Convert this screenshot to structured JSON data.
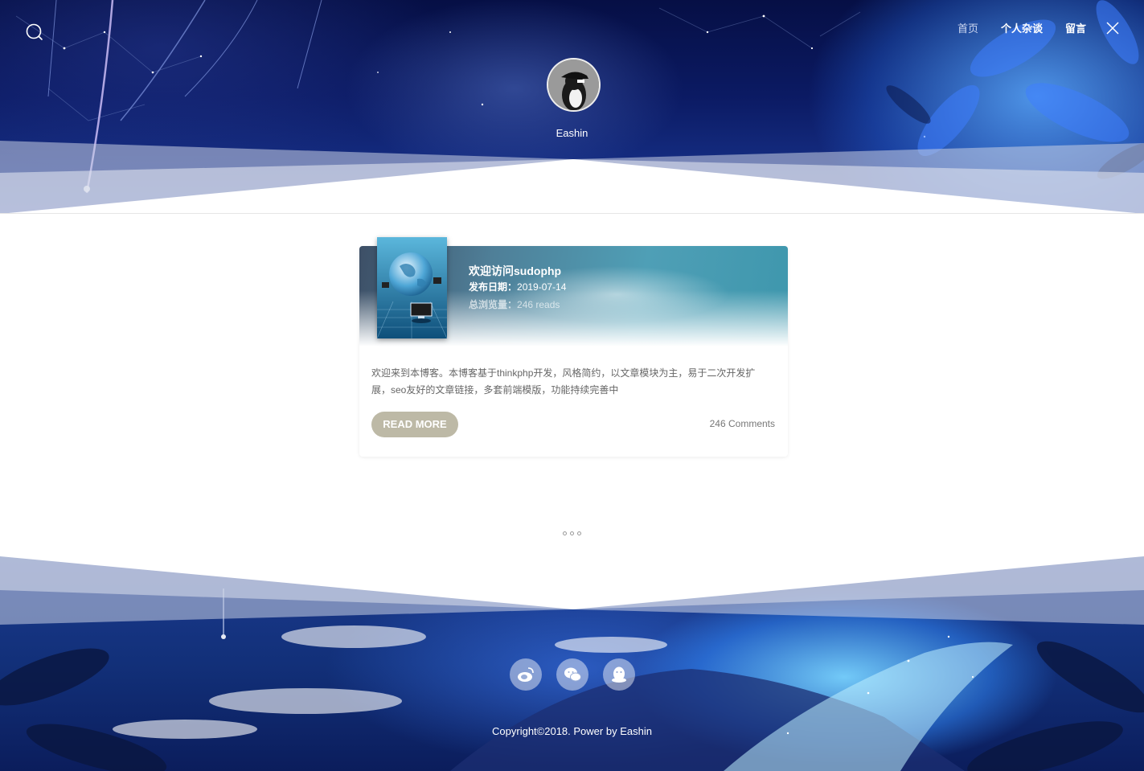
{
  "header": {
    "nav": [
      "首页",
      "个人杂谈",
      "留言"
    ],
    "author": "Eashin"
  },
  "post": {
    "title": "欢迎访问sudophp",
    "date_label": "发布日期：",
    "date": "2019-07-14",
    "reads_label": "总浏览量：",
    "reads": "246 reads",
    "excerpt": "欢迎来到本博客。本博客基于thinkphp开发，风格简约，以文章模块为主，易于二次开发扩展，seo友好的文章链接，多套前端模版，功能持续完善中",
    "read_more": "READ MORE",
    "comments": "246 Comments"
  },
  "footer": {
    "social_icons": [
      "weibo-icon",
      "wechat-icon",
      "qq-icon"
    ],
    "copyright": "Copyright©2018. Power by Eashin"
  },
  "colors": {
    "accent_button": "#bdb9a6",
    "header_dark": "#0b1a63"
  }
}
